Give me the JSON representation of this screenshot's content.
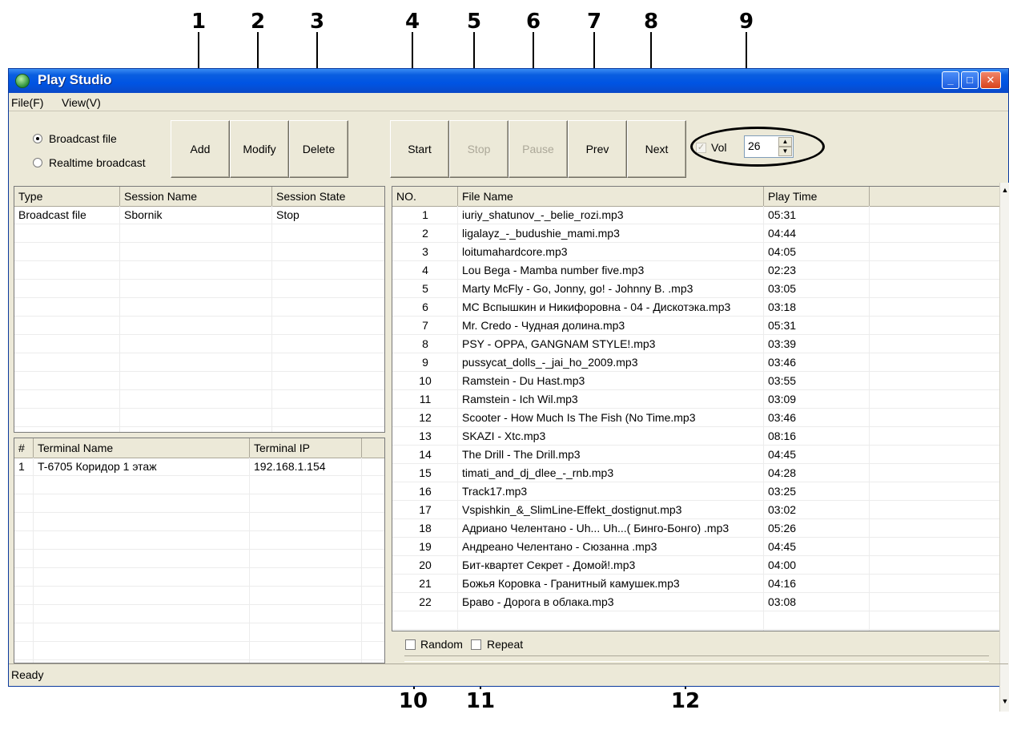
{
  "window": {
    "title": "Play Studio",
    "accent_color": "#0054e3",
    "controls": {
      "minimize_icon": "minimize-icon",
      "maximize_icon": "maximize-icon",
      "close_icon": "close-icon"
    }
  },
  "menu": [
    "File(F)",
    "View(V)"
  ],
  "mode": {
    "options": [
      {
        "label": "Broadcast file",
        "checked": true
      },
      {
        "label": "Realtime broadcast",
        "checked": false
      }
    ]
  },
  "session_buttons": {
    "add": "Add",
    "modify": "Modify",
    "delete": "Delete"
  },
  "playback_buttons": {
    "start": "Start",
    "stop": "Stop",
    "pause": "Pause",
    "prev": "Prev",
    "next": "Next",
    "stop_disabled": true,
    "pause_disabled": true
  },
  "volume": {
    "label": "Vol",
    "value": "26",
    "enabled_checked": true
  },
  "sessions": {
    "columns": [
      "Type",
      "Session Name",
      "Session State"
    ],
    "rows": [
      {
        "type": "Broadcast file",
        "name": "Sbornik",
        "state": "Stop"
      }
    ]
  },
  "terminals": {
    "columns": [
      "#",
      "Terminal Name",
      "Terminal IP"
    ],
    "rows": [
      {
        "num": "1",
        "name": "T-6705 Коридор 1 этаж",
        "ip": "192.168.1.154"
      }
    ]
  },
  "playlist": {
    "columns": [
      "NO.",
      "File Name",
      "Play Time"
    ],
    "rows": [
      {
        "no": "1",
        "file": "iuriy_shatunov_-_belie_rozi.mp3",
        "time": "05:31"
      },
      {
        "no": "2",
        "file": "ligalayz_-_budushie_mami.mp3",
        "time": "04:44"
      },
      {
        "no": "3",
        "file": "loitumahardcore.mp3",
        "time": "04:05"
      },
      {
        "no": "4",
        "file": "Lou Bega - Mamba number  five.mp3",
        "time": "02:23"
      },
      {
        "no": "5",
        "file": "Marty McFly  -  Go, Jonny,  go! - Johnny B. .mp3",
        "time": "03:05"
      },
      {
        "no": "6",
        "file": "MC Вспышкин и Никифоровна - 04 - Дискотэка.mp3",
        "time": "03:18"
      },
      {
        "no": "7",
        "file": "Mr. Credo - Чудная долина.mp3",
        "time": "05:31"
      },
      {
        "no": "8",
        "file": "PSY - OPPA, GANGNAM STYLE!.mp3",
        "time": "03:39"
      },
      {
        "no": "9",
        "file": "pussycat_dolls_-_jai_ho_2009.mp3",
        "time": "03:46"
      },
      {
        "no": "10",
        "file": "Ramstein - Du Hast.mp3",
        "time": "03:55"
      },
      {
        "no": "11",
        "file": "Ramstein - Ich Wil.mp3",
        "time": "03:09"
      },
      {
        "no": "12",
        "file": "Scooter - How Much Is The Fish (No Time.mp3",
        "time": "03:46"
      },
      {
        "no": "13",
        "file": "SKAZI - Xtc.mp3",
        "time": "08:16"
      },
      {
        "no": "14",
        "file": "The  Drill -  The  Drill.mp3",
        "time": "04:45"
      },
      {
        "no": "15",
        "file": "timati_and_dj_dlee_-_rnb.mp3",
        "time": "04:28"
      },
      {
        "no": "16",
        "file": "Track17.mp3",
        "time": "03:25"
      },
      {
        "no": "17",
        "file": "Vspishkin_&_SlimLine-Effekt_dostignut.mp3",
        "time": "03:02"
      },
      {
        "no": "18",
        "file": "Адриано Челентано - Uh... Uh...( Бинго-Бонго) .mp3",
        "time": "05:26"
      },
      {
        "no": "19",
        "file": "Андреано Челентано - Сюзанна .mp3",
        "time": "04:45"
      },
      {
        "no": "20",
        "file": "Бит-квартет Секрет - Домой!.mp3",
        "time": "04:00"
      },
      {
        "no": "21",
        "file": "Божья Коровка - Гранитный камушек.mp3",
        "time": "04:16"
      },
      {
        "no": "22",
        "file": "Браво - Дорога в облака.mp3",
        "time": "03:08"
      }
    ]
  },
  "options": {
    "random": "Random",
    "repeat": "Repeat",
    "random_checked": false,
    "repeat_checked": false
  },
  "status": "Ready",
  "callouts": [
    "1",
    "2",
    "3",
    "4",
    "5",
    "6",
    "7",
    "8",
    "9",
    "10",
    "11",
    "12"
  ]
}
